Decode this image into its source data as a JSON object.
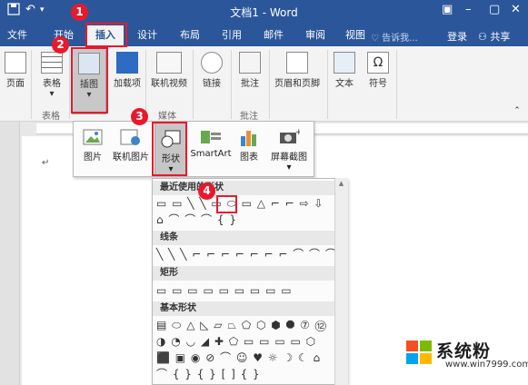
{
  "window": {
    "title": "文档1 - Word"
  },
  "tabs": [
    {
      "label": "文件"
    },
    {
      "label": "开始"
    },
    {
      "label": "插入"
    },
    {
      "label": "设计"
    },
    {
      "label": "布局"
    },
    {
      "label": "引用"
    },
    {
      "label": "邮件"
    },
    {
      "label": "审阅"
    },
    {
      "label": "视图"
    }
  ],
  "tell_me": "告诉我...",
  "login": "登录",
  "share": "共享",
  "ribbon": {
    "page_label": "页面",
    "table_label": "表格",
    "illus_label": "插图",
    "addins_label": "加载项",
    "online_video_label": "联机视频",
    "link_label": "链接",
    "comment_label": "批注",
    "header_footer_label": "页眉和页脚",
    "text_label": "文本",
    "symbol_label": "符号",
    "groups": {
      "table": "表格",
      "media": "媒体",
      "comments": "批注"
    }
  },
  "illus_menu": {
    "picture": "图片",
    "online_picture": "联机图片",
    "shapes": "形状",
    "smartart": "SmartArt",
    "chart": "图表",
    "screenshot": "屏幕截图"
  },
  "gallery": {
    "sections": [
      {
        "title": "最近使用的形状"
      },
      {
        "title": "线条"
      },
      {
        "title": "矩形"
      },
      {
        "title": "基本形状"
      }
    ],
    "rows": {
      "recent1": "▭ ▭ ╲ ╲ ▭ ⬭ ▭ △ ⌐ ⌐ ⇨ ⇩",
      "recent2": "⌂ ⌒ ⌒ ⌒ { }",
      "lines": "╲ ╲ ╲ ⌐ ⌐ ⌐ ⌐ ⌐ ⌐ ⌐ ⌒ ⌒ ⌒",
      "rects": "▭ ▭ ▭ ▭ ▭ ▭ ▭ ▭ ▭",
      "basic1": "▤ ⬭ △ ◺ ▱ ⏢ ⬠ ⬡ ⬢ ⯃ ⑦ ⑫",
      "basic2": "◑ ◔ ◡ ◢ ✚ ⬠ ▭ ▭ ▭ ▭ ⬡",
      "basic3": "⬛ ▣ ◉ ⊘ ⌒ ☺ ♥ ☼ ☽ ☾ ⌂",
      "basic4": "⌒ { } { } [ ] { }"
    }
  },
  "callouts": [
    "1",
    "2",
    "3",
    "4"
  ],
  "watermark": {
    "text": "系统粉",
    "url": "www.win7999.com"
  },
  "colors": {
    "accent": "#2b579a",
    "callout": "#e8192c"
  }
}
